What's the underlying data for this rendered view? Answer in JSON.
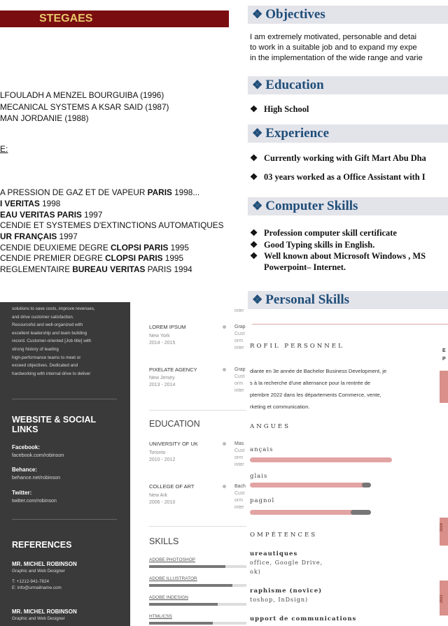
{
  "top_left": {
    "banner": "STEGAES",
    "lines_a": [
      "LFOULADH A MENZEL BOURGUIBA (1996)",
      "MECANICAL SYSTEMS A KSAR SAID (1987)",
      "MAN JORDANIE (1988)"
    ],
    "underlined": "E:",
    "lines_b": [
      {
        "pre": "A PRESSION DE GAZ ET DE VAPEUR ",
        "bold": "PARIS",
        "post": " 1998..."
      },
      {
        "pre": "",
        "bold": "I VERITAS",
        "post": " 1998"
      },
      {
        "pre": "",
        "bold": "EAU VERITAS PARIS",
        "post": " 1997"
      },
      {
        "pre": "CENDIE ET SYSTEMES D'EXTINCTIONS AUTOMATIQUES",
        "bold": "",
        "post": ""
      },
      {
        "pre": "",
        "bold": "UR FRANÇAIS",
        "post": " 1997"
      },
      {
        "pre": "CENDIE DEUXIEME DEGRE ",
        "bold": "CLOPSI PARIS",
        "post": " 1995"
      },
      {
        "pre": "CENDIE PREMIER DEGRE ",
        "bold": "CLOPSI PARIS",
        "post": " 1995"
      },
      {
        "pre": "REGLEMENTAIRE ",
        "bold": "BUREAU VERITAS",
        "post": " PARIS 1994"
      }
    ]
  },
  "top_right": {
    "objectives_title": "Objectives",
    "objectives_text": [
      "I am extremely motivated, personable and detai",
      "to work in a suitable job and to expand my expe",
      "in the implementation of the wide range and varie"
    ],
    "education_title": "Education",
    "education_item": "High School",
    "experience_title": "Experience",
    "experience_items": [
      "Currently working with Gift Mart Abu Dha",
      "03 years worked as a Office Assistant with I"
    ],
    "computer_title": "Computer Skills",
    "computer_items": [
      "Profession computer skill certificate",
      "Good Typing skills in  English.",
      "Well known about Microsoft Windows , MS"
    ],
    "computer_item_cont": "Powerpoint– Internet.",
    "personal_title": "Personal Skills",
    "bullet_glyph": "❖"
  },
  "dark_panel": {
    "intro": [
      "solutions to save costs, improve revenues,",
      "and drive customer satisfaction.",
      "Resourceful and well-organized with",
      "excellent leadership and team building",
      "record. Customer-oriented [Job title] with",
      "strong history of leading",
      "high-performance teams to meet or",
      "exceed objectives. Dedicated and",
      "hardworking with internal drive to deliver"
    ],
    "website_title_1": "WEBSITE & SOCIAL",
    "website_title_2": "LINKS",
    "facebook_label": "Facebook:",
    "facebook_value": "facebook.com/robinson",
    "behance_label": "Behance:",
    "behance_value": "behance.net/robinson",
    "twitter_label": "Twitter:",
    "twitter_value": "twitter.com/robinson",
    "references_title": "REFERENCES",
    "ref1_name": "MR. MICHEL ROBINSON",
    "ref1_role": "Graphic and Web Designer",
    "ref1_phone": "T: +1212-941-7824",
    "ref1_email": "E: info@urmailname.com",
    "ref2_name": "MR. MICHEL ROBINSON",
    "ref2_role": "Graphic and Web Designer"
  },
  "middle": {
    "top_inter": "inter",
    "job1_company": "LOREM IPSUM",
    "job1_city": "New York",
    "job1_years": "2014 - 2015",
    "job1_r": [
      "Grap",
      "Cust",
      "orm",
      "inter"
    ],
    "job2_company": "PIXELATE AGENCY",
    "job2_city": "New Jersey",
    "job2_years": "2013 - 2014",
    "job2_r": [
      "Grap",
      "Cust",
      "orm",
      "inter"
    ],
    "education_title": "EDUCATION",
    "edu1_school": "UNIVERSITY OF UK",
    "edu1_city": "Toronto",
    "edu1_years": "2010 - 2012",
    "edu1_r": [
      "Mas",
      "Cust",
      "orm",
      "inter"
    ],
    "edu2_school": "COLLEGE OF ART",
    "edu2_city": "New Ark",
    "edu2_years": "2006 - 2010",
    "edu2_r": [
      "Bach",
      "Cust",
      "orm",
      "inter"
    ],
    "skills_title": "SKILLS",
    "skills": [
      {
        "name": "ADOBE PHOTOSHOP",
        "level": 0.78
      },
      {
        "name": "ADOBE ILLUSTRATOR",
        "level": 0.85
      },
      {
        "name": "ADOBE INDESIGN",
        "level": 0.7
      },
      {
        "name": "HTML/CSS",
        "level": 0.65
      }
    ]
  },
  "bottom_right": {
    "profile_title": "ROFIL PERSONNEL",
    "profile_text": [
      "diante en 3e année de Bachelor Business Development, je",
      "s à la recherche d'une alternance pour la rentrée de",
      "ptembre 2022 dans les départements Commerce, vente,",
      "rketing et communication."
    ],
    "languages_title": "ANGUES",
    "languages": [
      {
        "name": "ançais",
        "level": 1.0
      },
      {
        "name": "glais",
        "level": 0.79
      },
      {
        "name": "pagnol",
        "level": 0.71
      }
    ],
    "skills_title": "OMPÉTENCES",
    "skill1_title": "ureautiques",
    "skill1_lines": [
      " office, Google Drive,",
      "ok)"
    ],
    "skill2_title": "raphisme (novice)",
    "skill2_lines": [
      "toshop, InDsign)"
    ],
    "skill3_title": "upport de communications",
    "side_letter_1": "E",
    "side_letter_2": "P",
    "side_year_1": "2018",
    "side_year_2": "2021",
    "accent": "#e2a3a3"
  }
}
